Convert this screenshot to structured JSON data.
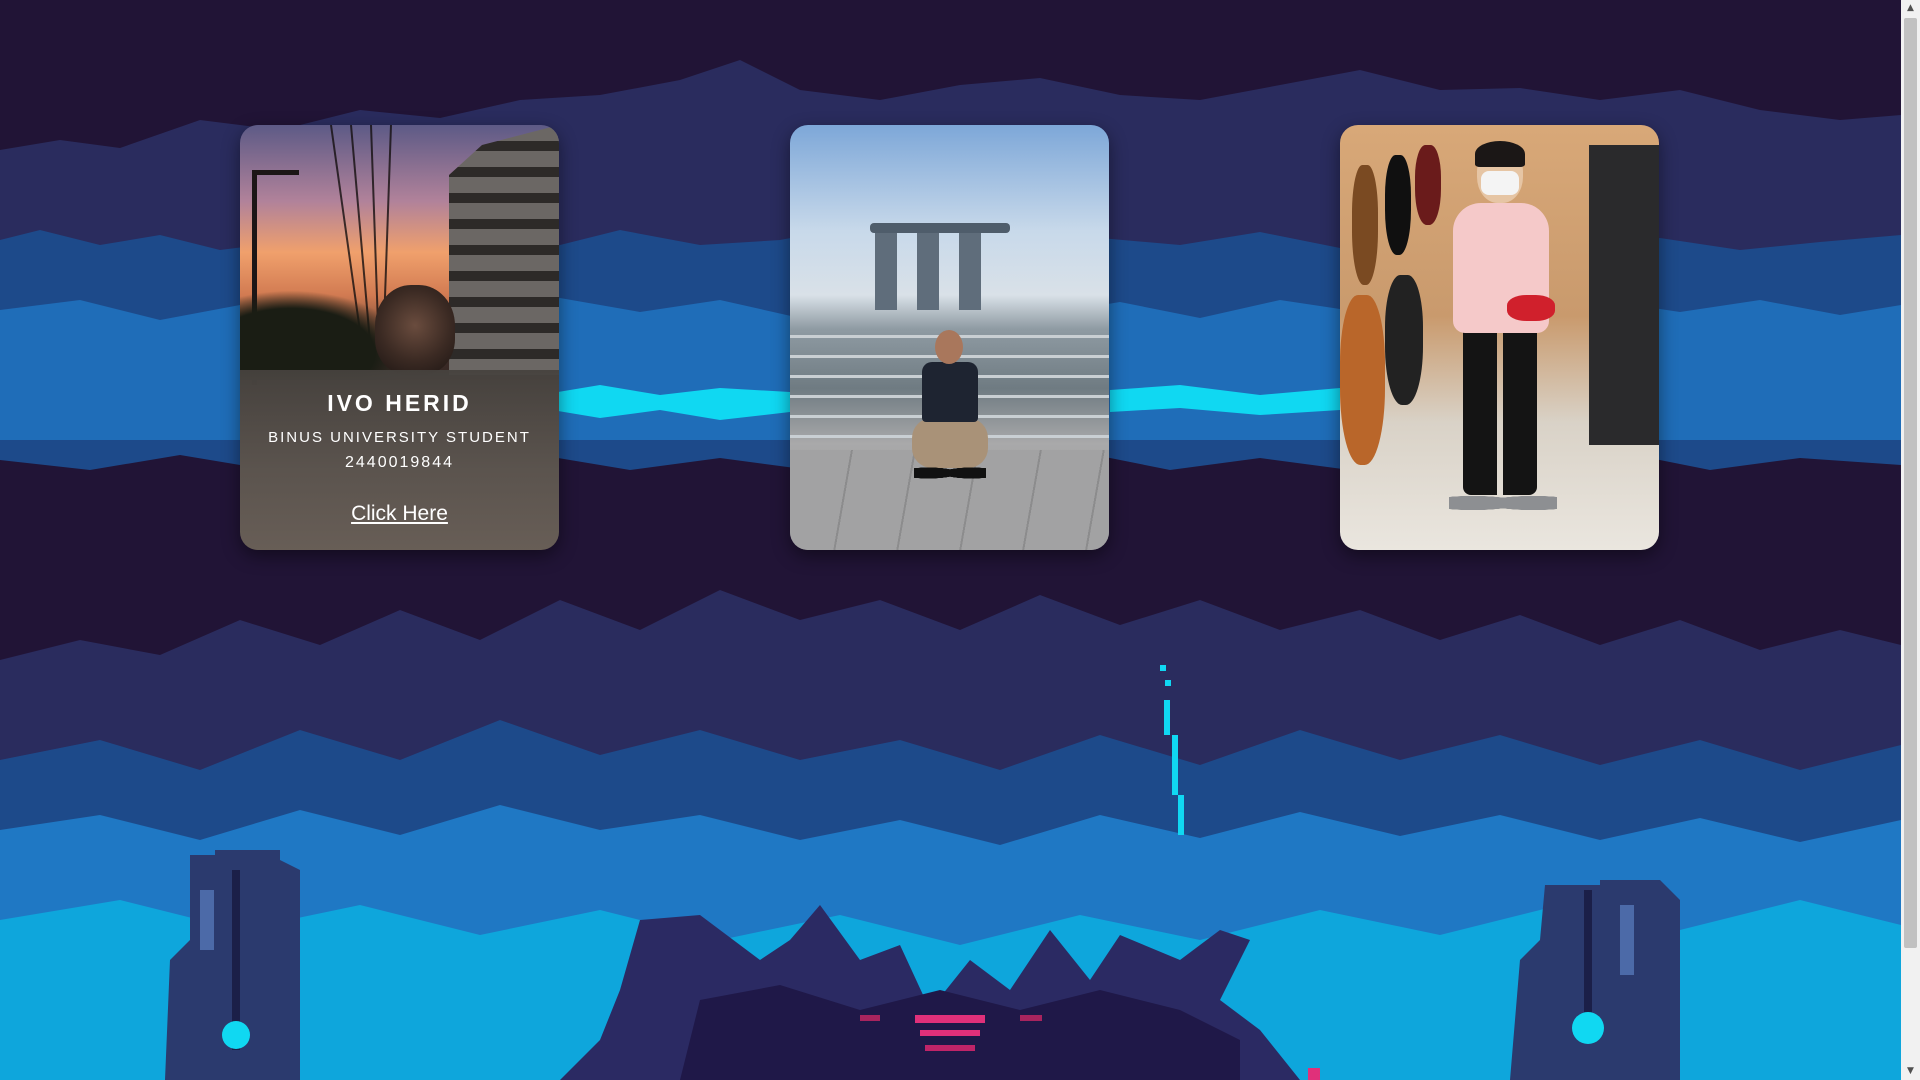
{
  "profile": {
    "name": "IVO HERID",
    "role": "BINUS UNIVERSITY STUDENT",
    "student_id": "2440019844",
    "link_label": "Click Here"
  },
  "cards": [
    {
      "photo": "sunset-selfie-photo"
    },
    {
      "photo": "marina-bay-waterfront-photo"
    },
    {
      "photo": "guitar-shop-photo"
    }
  ],
  "scrollbar": {
    "up_icon": "▲",
    "down_icon": "▼"
  },
  "colors": {
    "background": "#211436",
    "band_dark": "#2a2a5e",
    "band_mid": "#1d4a8a",
    "band_light": "#1f78c4",
    "cyan_stream": "#10d8f2",
    "accent_pink": "#e0307a"
  }
}
